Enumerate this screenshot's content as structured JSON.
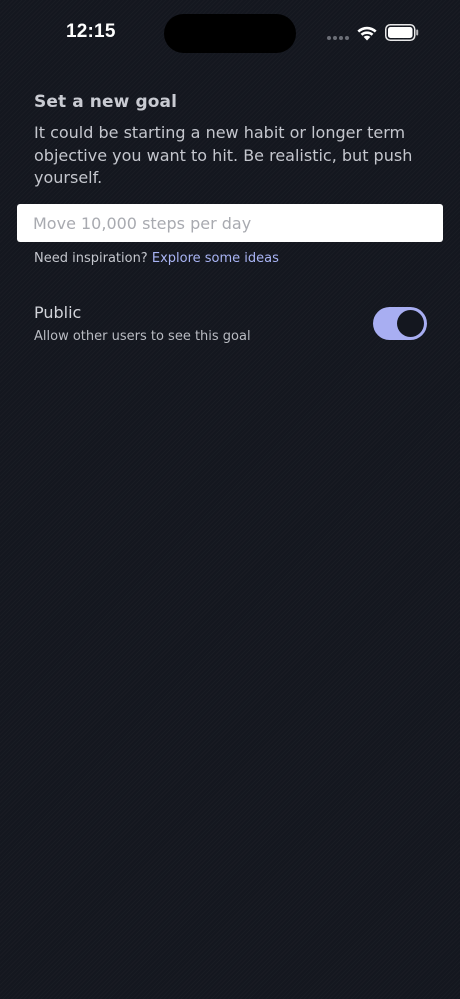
{
  "status_bar": {
    "time": "12:15",
    "icons": [
      "cellular-signal-icon",
      "wifi-icon",
      "battery-icon"
    ]
  },
  "goal": {
    "title": "Set a new goal",
    "description": "It could be starting a new habit or longer term objective you want to hit. Be realistic, but push yourself.",
    "input_value": "",
    "input_placeholder": "Move 10,000 steps per day",
    "inspiration_prefix": "Need inspiration?",
    "inspiration_link": "Explore some ideas"
  },
  "public_setting": {
    "label": "Public",
    "description": "Allow other users to see this goal",
    "enabled": true
  },
  "colors": {
    "background": "#14171f",
    "accent": "#a8aef2",
    "link": "#a9b4f4",
    "input_background": "#ffffff"
  }
}
